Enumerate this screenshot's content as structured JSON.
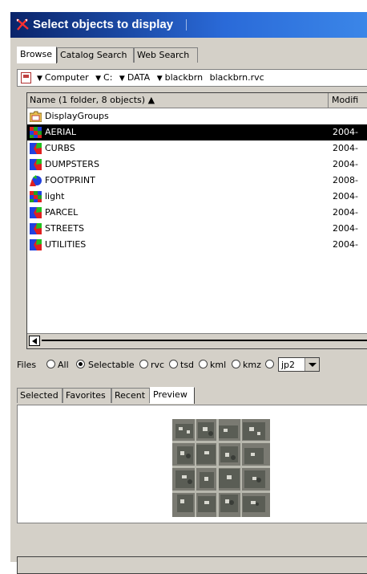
{
  "window": {
    "title": "Select objects to display",
    "title_icon": "app-arrows-icon"
  },
  "tabs": [
    {
      "label": "Browse",
      "active": true
    },
    {
      "label": "Catalog Search",
      "active": false
    },
    {
      "label": "Web Search",
      "active": false
    }
  ],
  "path": {
    "icon": "image-file-icon",
    "crumbs": [
      "Computer",
      "C:",
      "DATA",
      "blackbrn",
      "blackbrn.rvc"
    ]
  },
  "filelist": {
    "header_name": "Name (1 folder, 8 objects) ▲",
    "header_modified": "Modifi",
    "rows": [
      {
        "name": "DisplayGroups",
        "date": "",
        "icon": "folder-icon",
        "selected": false
      },
      {
        "name": "AERIAL",
        "date": "2004-",
        "icon": "raster-icon",
        "selected": true
      },
      {
        "name": "CURBS",
        "date": "2004-",
        "icon": "vector-icon",
        "selected": false
      },
      {
        "name": "DUMPSTERS",
        "date": "2004-",
        "icon": "vector-icon",
        "selected": false
      },
      {
        "name": "FOOTPRINT",
        "date": "2008-",
        "icon": "shape-icon",
        "selected": false
      },
      {
        "name": "light",
        "date": "2004-",
        "icon": "raster-icon",
        "selected": false
      },
      {
        "name": "PARCEL",
        "date": "2004-",
        "icon": "vector-icon",
        "selected": false
      },
      {
        "name": "STREETS",
        "date": "2004-",
        "icon": "vector-icon",
        "selected": false
      },
      {
        "name": "UTILITIES",
        "date": "2004-",
        "icon": "vector-icon",
        "selected": false
      }
    ]
  },
  "filters": {
    "label": "Files",
    "options": [
      {
        "label": "All",
        "checked": false
      },
      {
        "label": "Selectable",
        "checked": true
      },
      {
        "label": "rvc",
        "checked": false
      },
      {
        "label": "tsd",
        "checked": false
      },
      {
        "label": "kml",
        "checked": false
      },
      {
        "label": "kmz",
        "checked": false
      },
      {
        "label": "",
        "checked": false
      }
    ],
    "format_value": "jp2"
  },
  "bottom_tabs": [
    {
      "label": "Selected",
      "active": false
    },
    {
      "label": "Favorites",
      "active": false
    },
    {
      "label": "Recent",
      "active": false
    },
    {
      "label": "Preview",
      "active": true
    }
  ],
  "preview": {
    "image": "aerial-thumbnail"
  },
  "colors": {
    "titlebar_start": "#0a246a",
    "titlebar_end": "#3b86e8",
    "face": "#d4d0c8",
    "selection": "#000000"
  }
}
